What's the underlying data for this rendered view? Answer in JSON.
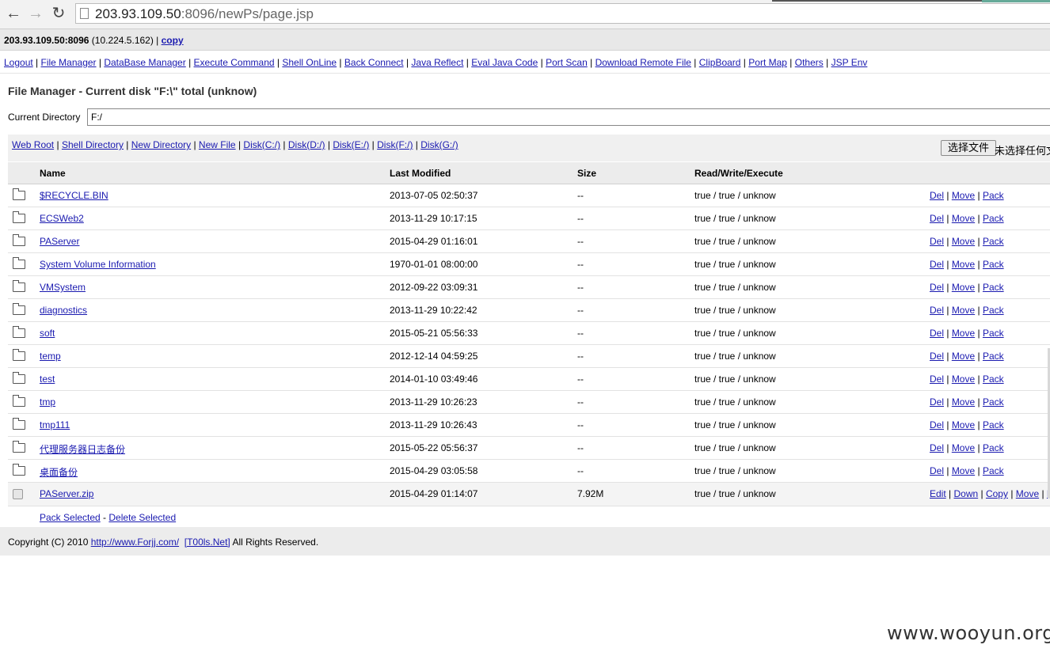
{
  "browser": {
    "url_host": "203.93.109.50",
    "url_rest": ":8096/newPs/page.jsp"
  },
  "hostbar": {
    "host": "203.93.109.50:8096",
    "ip": " (10.224.5.162) | ",
    "copy": "copy"
  },
  "menu": [
    "Logout",
    "File Manager",
    "DataBase Manager",
    "Execute Command",
    "Shell OnLine",
    "Back Connect",
    "Java Reflect",
    "Eval Java Code",
    "Port Scan",
    "Download Remote File",
    "ClipBoard",
    "Port Map",
    "Others",
    "JSP Env"
  ],
  "title": "File Manager - Current disk \"F:\\\" total (unknow)",
  "curdir": {
    "label": "Current Directory",
    "value": "F:/"
  },
  "toolbar": {
    "links": [
      "Web Root",
      "Shell Directory",
      "New Directory",
      "New File",
      "Disk(C:/)",
      "Disk(D:/)",
      "Disk(E:/)",
      "Disk(F:/)",
      "Disk(G:/)"
    ],
    "choose_file": "选择文件",
    "no_file": "未选择任何文件"
  },
  "table": {
    "headers": {
      "name": "Name",
      "modified": "Last Modified",
      "size": "Size",
      "rwe": "Read/Write/Execute"
    },
    "folders": [
      {
        "name": "$RECYCLE.BIN",
        "modified": "2013-07-05 02:50:37",
        "size": "--",
        "rwe": "true / true / unknow"
      },
      {
        "name": "ECSWeb2",
        "modified": "2013-11-29 10:17:15",
        "size": "--",
        "rwe": "true / true / unknow"
      },
      {
        "name": "PAServer",
        "modified": "2015-04-29 01:16:01",
        "size": "--",
        "rwe": "true / true / unknow"
      },
      {
        "name": "System Volume Information",
        "modified": "1970-01-01 08:00:00",
        "size": "--",
        "rwe": "true / true / unknow"
      },
      {
        "name": "VMSystem",
        "modified": "2012-09-22 03:09:31",
        "size": "--",
        "rwe": "true / true / unknow"
      },
      {
        "name": "diagnostics",
        "modified": "2013-11-29 10:22:42",
        "size": "--",
        "rwe": "true / true / unknow"
      },
      {
        "name": "soft",
        "modified": "2015-05-21 05:56:33",
        "size": "--",
        "rwe": "true / true / unknow"
      },
      {
        "name": "temp",
        "modified": "2012-12-14 04:59:25",
        "size": "--",
        "rwe": "true / true / unknow"
      },
      {
        "name": "test",
        "modified": "2014-01-10 03:49:46",
        "size": "--",
        "rwe": "true / true / unknow"
      },
      {
        "name": "tmp",
        "modified": "2013-11-29 10:26:23",
        "size": "--",
        "rwe": "true / true / unknow"
      },
      {
        "name": "tmp111",
        "modified": "2013-11-29 10:26:43",
        "size": "--",
        "rwe": "true / true / unknow"
      },
      {
        "name": "代理服务器日志备份",
        "modified": "2015-05-22 05:56:37",
        "size": "--",
        "rwe": "true / true / unknow"
      },
      {
        "name": "桌面备份",
        "modified": "2015-04-29 03:05:58",
        "size": "--",
        "rwe": "true / true / unknow"
      }
    ],
    "folder_actions": [
      "Del",
      "Move",
      "Pack"
    ],
    "file": {
      "name": "PAServer.zip",
      "modified": "2015-04-29 01:14:07",
      "size": "7.92M",
      "rwe": "true / true / unknow"
    },
    "file_actions": [
      "Edit",
      "Down",
      "Copy",
      "Move",
      "R"
    ],
    "pack_selected": "Pack Selected",
    "dash": " - ",
    "delete_selected": "Delete Selected"
  },
  "copyright": {
    "prefix": "Copyright (C) 2010 ",
    "link1": "http://www.Forjj.com/",
    "link2": "[T00ls.Net]",
    "suffix": " All Rights Reserved."
  },
  "watermark": "www.wooyun.org"
}
